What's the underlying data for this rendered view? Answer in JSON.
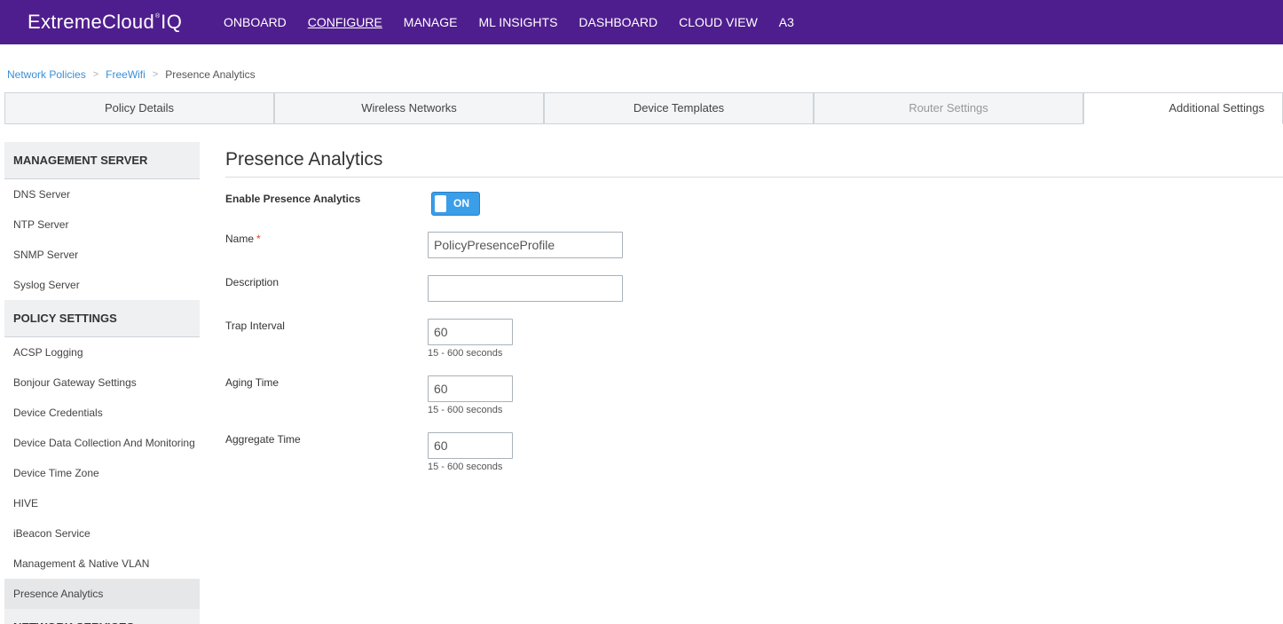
{
  "brand": {
    "word": "ExtremeCloud",
    "reg": "®",
    "suffix": "IQ"
  },
  "nav": {
    "items": [
      {
        "label": "ONBOARD"
      },
      {
        "label": "CONFIGURE"
      },
      {
        "label": "MANAGE"
      },
      {
        "label": "ML INSIGHTS"
      },
      {
        "label": "DASHBOARD"
      },
      {
        "label": "CLOUD VIEW"
      },
      {
        "label": "A3"
      }
    ],
    "active": "CONFIGURE"
  },
  "breadcrumb": {
    "items": [
      {
        "label": "Network Policies"
      },
      {
        "label": "FreeWifi"
      },
      {
        "label": "Presence Analytics"
      }
    ],
    "separator": ">"
  },
  "tabs": [
    {
      "label": "Policy Details"
    },
    {
      "label": "Wireless Networks"
    },
    {
      "label": "Device Templates"
    },
    {
      "label": "Router Settings"
    },
    {
      "label": "Additional Settings"
    }
  ],
  "sidebar": {
    "management_header": "MANAGEMENT SERVER",
    "management_items": [
      {
        "label": "DNS Server"
      },
      {
        "label": "NTP Server"
      },
      {
        "label": "SNMP Server"
      },
      {
        "label": "Syslog Server"
      }
    ],
    "policy_header": "POLICY SETTINGS",
    "policy_items": [
      {
        "label": "ACSP Logging"
      },
      {
        "label": "Bonjour Gateway Settings"
      },
      {
        "label": "Device Credentials"
      },
      {
        "label": "Device Data Collection And Monitoring"
      },
      {
        "label": "Device Time Zone"
      },
      {
        "label": "HIVE"
      },
      {
        "label": "iBeacon Service"
      },
      {
        "label": "Management & Native VLAN"
      },
      {
        "label": "Presence Analytics"
      }
    ],
    "network_header": "NETWORK SERVICES"
  },
  "form": {
    "title": "Presence Analytics",
    "enable_label": "Enable Presence Analytics",
    "enable_state": "ON",
    "name_label": "Name",
    "name_required": "*",
    "name_value": "PolicyPresenceProfile",
    "description_label": "Description",
    "description_value": "",
    "trap_label": "Trap Interval",
    "trap_value": "60",
    "trap_hint": "15 - 600 seconds",
    "aging_label": "Aging Time",
    "aging_value": "60",
    "aging_hint": "15 - 600 seconds",
    "aggregate_label": "Aggregate Time",
    "aggregate_value": "60",
    "aggregate_hint": "15 - 600 seconds"
  },
  "colors": {
    "topbar": "#4f1e8e",
    "link": "#3a8fd6",
    "toggle_on": "#3a9ee9",
    "required": "#e0402a"
  }
}
